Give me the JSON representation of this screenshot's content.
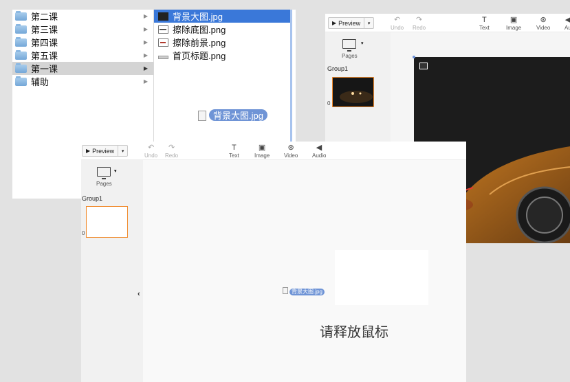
{
  "finder": {
    "folders": [
      {
        "label": "第二课"
      },
      {
        "label": "第三课"
      },
      {
        "label": "第四课"
      },
      {
        "label": "第五课"
      },
      {
        "label": "第一课"
      },
      {
        "label": "辅助"
      }
    ],
    "files": [
      {
        "label": "背景大图.jpg"
      },
      {
        "label": "擦除底图.png"
      },
      {
        "label": "擦除前景.png"
      },
      {
        "label": "首页标题.png"
      }
    ],
    "drag_label": "背景大图.jpg"
  },
  "editor_front": {
    "preview_label": "Preview",
    "tools": {
      "undo": "Undo",
      "redo": "Redo",
      "text": "Text",
      "image": "Image",
      "video": "Video",
      "audio": "Audio"
    },
    "pages_label": "Pages",
    "group_label": "Group1",
    "thumb_number": "0",
    "drag_label": "背景大图.jpg",
    "release_hint": "请释放鼠标"
  },
  "editor_back": {
    "preview_label": "Preview",
    "tools": {
      "undo": "Undo",
      "redo": "Redo",
      "text": "Text",
      "image": "Image",
      "video": "Video",
      "audio": "Audio"
    },
    "pages_label": "Pages",
    "group_label": "Group1",
    "thumb_number": "0"
  },
  "icons": [
    "folder-icon",
    "file-icon",
    "play-icon",
    "undo-icon",
    "redo-icon",
    "text-icon",
    "image-icon",
    "video-icon",
    "audio-icon",
    "monitor-icon",
    "chevron-left-icon"
  ],
  "colors": {
    "selection_blue": "#3a78d9",
    "accent_orange": "#f08a2c",
    "finder_select_gray": "#d4d4d4"
  }
}
